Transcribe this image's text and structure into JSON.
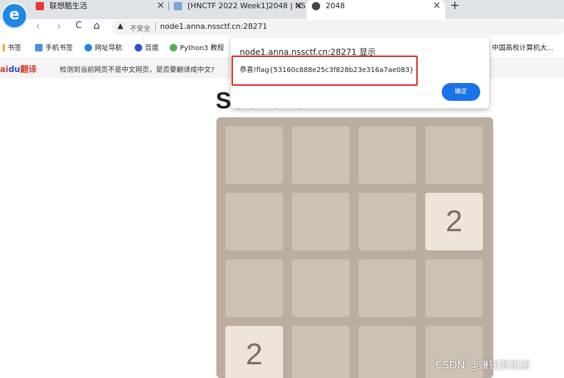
{
  "browser": {
    "logo_glyph": "e",
    "tabs": [
      {
        "label": "联想酷生活",
        "icon": "lenovo-icon",
        "active": false
      },
      {
        "label": "[HNCTF 2022 Week1]2048 | NS",
        "icon": "nssctf-icon",
        "active": false
      },
      {
        "label": "2048",
        "icon": "edge-icon",
        "active": true
      }
    ],
    "new_tab_glyph": "+",
    "close_glyph": "×",
    "nav": {
      "back": "‹",
      "forward": "›",
      "reload": "C",
      "home": "⌂"
    },
    "omnibox": {
      "warning_glyph": "▲",
      "security": "不安全",
      "url": "node1.anna.nssctf.cn:28271"
    }
  },
  "bookmarks": [
    {
      "label": "书签",
      "color": "#f0a500"
    },
    {
      "label": "手机书签",
      "color": "#4a90e2"
    },
    {
      "label": "网址导航",
      "color": "#1e88e5"
    },
    {
      "label": "百度",
      "color": "#2b4fd7"
    },
    {
      "label": "Python3 教程",
      "color": "#4caf50"
    },
    {
      "label": "中国高校计算机大...",
      "color": ""
    }
  ],
  "translate_bar": {
    "logo_prefix": "ai",
    "logo_paw": "du",
    "logo_suffix": "翻译",
    "message": "检测到当前网页不是中文网页，是否要翻译成中文?"
  },
  "game": {
    "title": "Score:0",
    "grid": [
      [
        "",
        "",
        "",
        ""
      ],
      [
        "",
        "",
        "",
        "2"
      ],
      [
        "",
        "",
        "",
        ""
      ],
      [
        "2",
        "",
        "",
        ""
      ]
    ],
    "colors": {
      "board": "#bbada0",
      "cell": "#cdc1b4",
      "tile2": "#eee4da"
    }
  },
  "dialog": {
    "title": "node1.anna.nssctf.cn:28271 显示",
    "message": "恭喜!flag{53160c888e25c3f828b23e316a7ae083}",
    "ok_label": "确定",
    "highlight_color": "#e02020",
    "button_color": "#1a73e8"
  },
  "watermark": "CSDN @赚钱娶甜甜"
}
